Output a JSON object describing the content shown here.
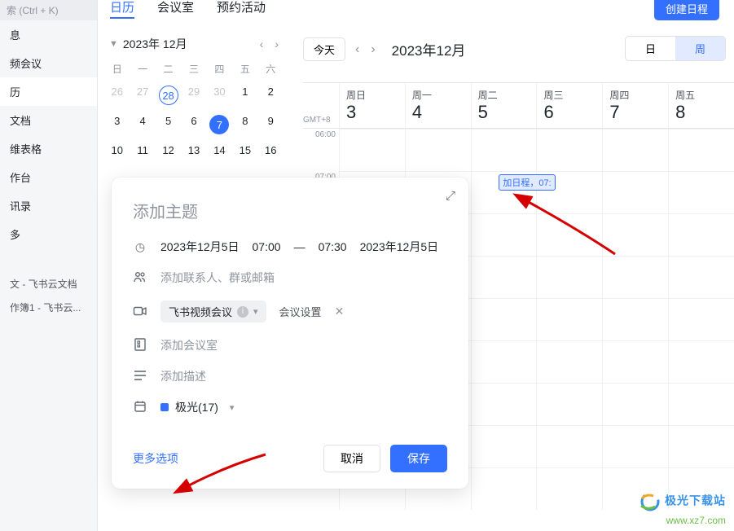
{
  "sidebar": {
    "search_hint": "索 (Ctrl + K)",
    "items": [
      "息",
      "频会议",
      "历",
      "文档",
      "维表格",
      "作台",
      "讯录",
      "多"
    ],
    "active_index": 2,
    "docs": [
      "文 - 飞书云文档",
      "作簿1 - 飞书云..."
    ]
  },
  "tabs": {
    "items": [
      "日历",
      "会议室",
      "预约活动"
    ],
    "active_index": 0
  },
  "create_button": "创建日程",
  "mini_cal": {
    "title": "2023年 12月",
    "dow": [
      "日",
      "一",
      "二",
      "三",
      "四",
      "五",
      "六"
    ],
    "rows": [
      [
        {
          "d": "26",
          "dim": true
        },
        {
          "d": "27",
          "dim": true
        },
        {
          "d": "28",
          "dim": true,
          "today": true
        },
        {
          "d": "29",
          "dim": true
        },
        {
          "d": "30",
          "dim": true
        },
        {
          "d": "1"
        },
        {
          "d": "2"
        }
      ],
      [
        {
          "d": "3"
        },
        {
          "d": "4"
        },
        {
          "d": "5"
        },
        {
          "d": "6"
        },
        {
          "d": "7",
          "selected": true
        },
        {
          "d": "8"
        },
        {
          "d": "9"
        }
      ],
      [
        {
          "d": "10"
        },
        {
          "d": "11"
        },
        {
          "d": "12"
        },
        {
          "d": "13"
        },
        {
          "d": "14"
        },
        {
          "d": "15"
        },
        {
          "d": "16"
        }
      ]
    ]
  },
  "main_cal": {
    "today_btn": "今天",
    "title": "2023年12月",
    "views": {
      "day": "日",
      "week": "周",
      "active": "week"
    },
    "gmt": "GMT+8",
    "days": [
      {
        "dow": "周日",
        "num": "3"
      },
      {
        "dow": "周一",
        "num": "4"
      },
      {
        "dow": "周二",
        "num": "5"
      },
      {
        "dow": "周三",
        "num": "6"
      },
      {
        "dow": "周四",
        "num": "7"
      },
      {
        "dow": "周五",
        "num": "8"
      }
    ],
    "time_labels": [
      "06:00",
      "07:00"
    ],
    "event_chip": "加日程，07:"
  },
  "popup": {
    "title_placeholder": "添加主题",
    "time": {
      "date1": "2023年12月5日",
      "start": "07:00",
      "sep": "—",
      "end": "07:30",
      "date2": "2023年12月5日"
    },
    "guests_placeholder": "添加联系人、群或邮箱",
    "video": {
      "label": "飞书视频会议",
      "settings": "会议设置"
    },
    "room_placeholder": "添加会议室",
    "desc_placeholder": "添加描述",
    "calendar": "极光(17)",
    "more_options": "更多选项",
    "cancel": "取消",
    "save": "保存"
  },
  "watermark": {
    "line1": "极光下载站",
    "line2": "www.xz7.com"
  }
}
